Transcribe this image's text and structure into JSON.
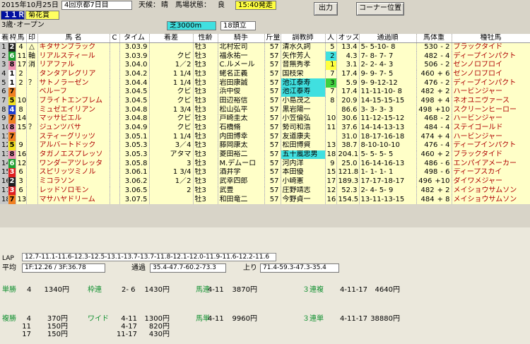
{
  "header": {
    "date": "2015年10月25日",
    "meeting": "4回京都7日目",
    "weather_label": "天候：",
    "weather": "晴",
    "track_label": "馬場状態：",
    "track": "良",
    "post_time": "15:40発走",
    "race_no": "１１Ｒ",
    "race_name": "菊花賞",
    "class": "3歳･オープン",
    "course": "芝3000m",
    "field_size": "18頭立",
    "print_button": "出力",
    "corner_button": "コーナー位置"
  },
  "columns": [
    "着",
    "枠",
    "馬",
    "印",
    "馬 名",
    "C",
    "タイム",
    "着差",
    "性齢",
    "騎手",
    "斤量",
    "調教師",
    "人",
    "オッズ",
    "通過順",
    "馬体重",
    "種牡馬"
  ],
  "rows": [
    {
      "rank": "1",
      "waku": "2",
      "uma": "4",
      "mark": "△",
      "name": "キタサンブラック",
      "c": "",
      "time": "3.03.9",
      "margin": "",
      "sexage": "牡3",
      "jockey": "北村宏司",
      "weight": "57",
      "trainer": "清水久詞",
      "pop": "5",
      "odds": "13.4",
      "pass": "5- 5-10- 8",
      "body": "530",
      "diff": "- 2",
      "sire": "ブラックタイド"
    },
    {
      "rank": "2",
      "waku": "6",
      "uma": "11",
      "mark": "軸",
      "name": "リアルスティール",
      "c": "",
      "time": "3.03.9",
      "margin": "クビ",
      "sexage": "牡3",
      "jockey": "福永祐一",
      "weight": "57",
      "trainer": "矢作芳人",
      "pop": "2",
      "odds": "4.3",
      "pass": "7- 8- 7- 7",
      "body": "482",
      "diff": "- 4",
      "sire": "ディープインパクト"
    },
    {
      "rank": "3",
      "waku": "8",
      "uma": "17",
      "mark": "消",
      "name": "リアファル",
      "c": "",
      "time": "3.04.0",
      "margin": "1／2",
      "sexage": "牡3",
      "jockey": "C.ルメール",
      "weight": "57",
      "trainer": "音無秀孝",
      "pop": "1",
      "odds": "3.1",
      "pass": "2- 2- 4- 3",
      "body": "506",
      "diff": "- 2",
      "sire": "ゼンノロブロイ"
    },
    {
      "rank": "4",
      "waku": "1",
      "uma": "2",
      "mark": "",
      "name": "タンタアレグリア",
      "c": "",
      "time": "3.04.2",
      "margin": "1 1/4",
      "sexage": "牡3",
      "jockey": "蛯名正義",
      "weight": "57",
      "trainer": "国枝栄",
      "pop": "7",
      "odds": "17.4",
      "pass": "9- 9- 7- 5",
      "body": "460",
      "diff": "+ 6",
      "sire": "ゼンノロブロイ"
    },
    {
      "rank": "5",
      "waku": "1",
      "uma": "2",
      "mark": "？",
      "name": "サトノラーゼン",
      "c": "",
      "time": "3.04.4",
      "margin": "1 1/4",
      "sexage": "牡3",
      "jockey": "岩田康誠",
      "weight": "57",
      "trainer": "池江泰寿",
      "pop": "3",
      "odds": "5.9",
      "pass": "9- 9-12-12",
      "body": "476",
      "diff": "- 2",
      "sire": "ディープインパクト"
    },
    {
      "rank": "6",
      "waku": "7",
      "uma": "",
      "mark": "",
      "name": "ベルーフ",
      "c": "",
      "time": "3.04.5",
      "margin": "クビ",
      "sexage": "牡3",
      "jockey": "浜中俊",
      "weight": "57",
      "trainer": "池江泰寿",
      "pop": "7",
      "odds": "17.4",
      "pass": "11-11-10- 8",
      "body": "482",
      "diff": "+ 2",
      "sire": "ハービンジャー"
    },
    {
      "rank": "7",
      "waku": "5",
      "uma": "10",
      "mark": "",
      "name": "ブライトエンブレム",
      "c": "",
      "time": "3.04.5",
      "margin": "クビ",
      "sexage": "牡3",
      "jockey": "田辺裕信",
      "weight": "57",
      "trainer": "小島茂之",
      "pop": "8",
      "odds": "20.9",
      "pass": "14-15-15-15",
      "body": "498",
      "diff": "+ 4",
      "sire": "ネオユニヴァース"
    },
    {
      "rank": "8",
      "waku": "4",
      "uma": "8",
      "mark": "",
      "name": "ミュゼエイリアン",
      "c": "",
      "time": "3.04.8",
      "margin": "1 3/4",
      "sexage": "牡3",
      "jockey": "松山弘平",
      "weight": "57",
      "trainer": "黒岩陽一",
      "pop": "",
      "odds": "86.6",
      "pass": "3- 3- 3- 3",
      "body": "498",
      "diff": "+10",
      "sire": "スクリーンヒーロー"
    },
    {
      "rank": "9",
      "waku": "7",
      "uma": "14",
      "mark": "",
      "name": "マッサビエル",
      "c": "",
      "time": "3.04.8",
      "margin": "クビ",
      "sexage": "牡3",
      "jockey": "戸崎圭太",
      "weight": "57",
      "trainer": "小笠倫弘",
      "pop": "10",
      "odds": "30.6",
      "pass": "11-12-15-12",
      "body": "468",
      "diff": "- 2",
      "sire": "ハービンジャー"
    },
    {
      "rank": "10",
      "waku": "8",
      "uma": "15",
      "mark": "？",
      "name": "ジュンツバサ",
      "c": "",
      "time": "3.04.9",
      "margin": "クビ",
      "sexage": "牡3",
      "jockey": "石橋脩",
      "weight": "57",
      "trainer": "勢司和浩",
      "pop": "11",
      "odds": "37.6",
      "pass": "14-14-13-13",
      "body": "484",
      "diff": "- 4",
      "sire": "ステイゴールド"
    },
    {
      "rank": "11",
      "waku": "7",
      "uma": "",
      "mark": "",
      "name": "スティーグリッツ",
      "c": "",
      "time": "3.05.1",
      "margin": "1 1/4",
      "sexage": "牡3",
      "jockey": "内田博幸",
      "weight": "57",
      "trainer": "友道康夫",
      "pop": "",
      "odds": "31.0",
      "pass": "18-17-16-18",
      "body": "474",
      "diff": "+ 4",
      "sire": "ハービンジャー"
    },
    {
      "rank": "12",
      "waku": "5",
      "uma": "9",
      "mark": "",
      "name": "アルバートドック",
      "c": "",
      "time": "3.05.3",
      "margin": "3／4",
      "sexage": "牡3",
      "jockey": "藤岡康太",
      "weight": "57",
      "trainer": "松田博資",
      "pop": "13",
      "odds": "38.7",
      "pass": "8-10-10-10",
      "body": "476",
      "diff": "- 4",
      "sire": "ディープインパクト"
    },
    {
      "rank": "13",
      "waku": "8",
      "uma": "16",
      "mark": "",
      "name": "タガノエスプレッソ",
      "c": "",
      "time": "3.05.3",
      "margin": "アタマ",
      "sexage": "牡3",
      "jockey": "菱田裕二",
      "weight": "57",
      "trainer": "五十嵐忠男",
      "pop": "18",
      "odds": "204.1",
      "pass": "5- 5- 5- 5",
      "body": "460",
      "diff": "+ 2",
      "sire": "ブラックタイド"
    },
    {
      "rank": "14",
      "waku": "6",
      "uma": "12",
      "mark": "",
      "name": "ワンダーアツレッタ",
      "c": "",
      "time": "3.05.8",
      "margin": "3",
      "sexage": "牡3",
      "jockey": "M.デムーロ",
      "weight": "57",
      "trainer": "河内洋",
      "pop": "9",
      "odds": "25.0",
      "pass": "16-14-16-13",
      "body": "486",
      "diff": "- 6",
      "sire": "エンパイアメーカー"
    },
    {
      "rank": "15",
      "waku": "3",
      "uma": "6",
      "mark": "",
      "name": "スピリッツミノル",
      "c": "",
      "time": "3.06.1",
      "margin": "1 3/4",
      "sexage": "牡3",
      "jockey": "酒井学",
      "weight": "57",
      "trainer": "本田優",
      "pop": "15",
      "odds": "121.8",
      "pass": "1- 1- 1- 1",
      "body": "498",
      "diff": "- 6",
      "sire": "ディープスカイ"
    },
    {
      "rank": "16",
      "waku": "2",
      "uma": "3",
      "mark": "",
      "name": "ミコラソン",
      "c": "",
      "time": "3.06.2",
      "margin": "1／2",
      "sexage": "牡3",
      "jockey": "武幸四郎",
      "weight": "57",
      "trainer": "小崎憲",
      "pop": "17",
      "odds": "189.3",
      "pass": "17-17-18-17",
      "body": "496",
      "diff": "+10",
      "sire": "ダイワメジャー"
    },
    {
      "rank": "17",
      "waku": "3",
      "uma": "6",
      "mark": "",
      "name": "レッドソロモン",
      "c": "",
      "time": "3.06.5",
      "margin": "2",
      "sexage": "牡3",
      "jockey": "武豊",
      "weight": "57",
      "trainer": "庄野靖志",
      "pop": "12",
      "odds": "52.3",
      "pass": "2- 4- 5- 9",
      "body": "482",
      "diff": "+ 2",
      "sire": "メイショウサムソン"
    },
    {
      "rank": "18",
      "waku": "7",
      "uma": "13",
      "mark": "",
      "name": "マサハヤドリーム",
      "c": "",
      "time": "3.07.5",
      "margin": "",
      "sexage": "牡3",
      "jockey": "和田竜二",
      "weight": "57",
      "trainer": "今野貞一",
      "pop": "16",
      "odds": "154.5",
      "pass": "13-11-13-15",
      "body": "484",
      "diff": "+ 8",
      "sire": "メイショウサムソン"
    }
  ],
  "lap": {
    "label": "LAP",
    "values": "12.7-11.1-11.6-12.3-12.5-13.1-13.7-13.7-11.8-12.1-12.0-11.9-11.6-12.2-11.6",
    "avg_label": "平均",
    "avg": "1F:12.26 / 3F:36.78",
    "pass_label": "通過",
    "pass": "35.4-47.7-60.2-73.3",
    "last_label": "上り",
    "last": "71.4-59.3-47.3-35.4"
  },
  "payouts": {
    "tansho": {
      "label": "単勝",
      "num": "4",
      "pay": "1340円"
    },
    "wakuren": {
      "label": "枠連",
      "num": "2- 6",
      "pay": "1430円"
    },
    "umaren": {
      "label": "馬連",
      "num": "4-11",
      "pay": "3870円"
    },
    "sanrenpuku": {
      "label": "３連複",
      "num": "4-11-17",
      "pay": "4640円"
    },
    "fukusho": {
      "label": "複勝",
      "rows": [
        {
          "num": "4",
          "pay": "370円"
        },
        {
          "num": "11",
          "pay": "150円"
        },
        {
          "num": "17",
          "pay": "150円"
        }
      ]
    },
    "wide": {
      "label": "ワイド",
      "rows": [
        {
          "num": "4-11",
          "pay": "1300円"
        },
        {
          "num": "4-17",
          "pay": "820円"
        },
        {
          "num": "11-17",
          "pay": "430円"
        }
      ]
    },
    "umatan": {
      "label": "馬単",
      "num": "4-11",
      "pay": "9960円"
    },
    "sanrentan": {
      "label": "３連単",
      "num": "4-11-17",
      "pay": "38880円"
    }
  },
  "waku_colors": {
    "1": "#ffffff",
    "2": "#202020",
    "3": "#e02020",
    "4": "#2040d0",
    "5": "#f0e020",
    "6": "#20a030",
    "7": "#f08020",
    "8": "#f090b0"
  },
  "waku_text": {
    "1": "#000000",
    "2": "#ffffff",
    "3": "#ffffff",
    "4": "#ffffff",
    "5": "#000000",
    "6": "#ffffff",
    "7": "#000000",
    "8": "#000000"
  }
}
